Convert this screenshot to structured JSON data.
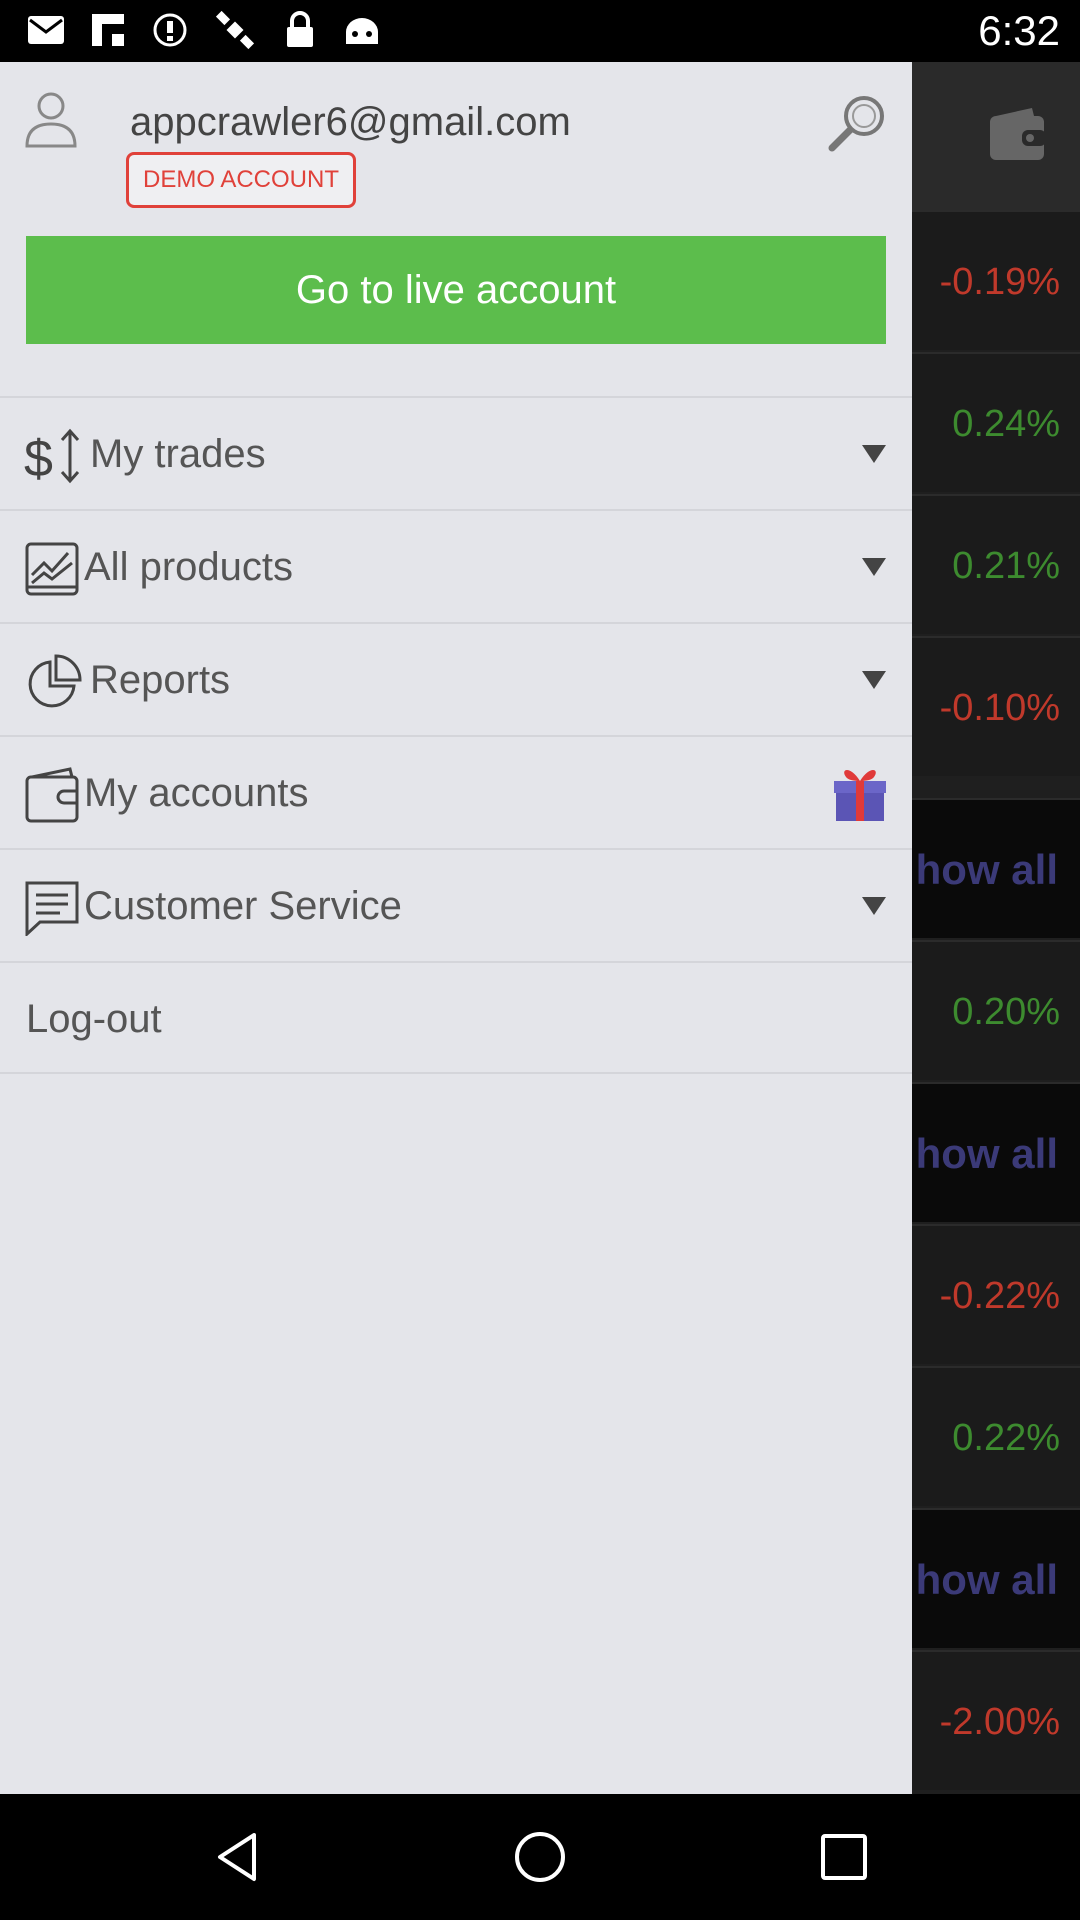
{
  "status_bar": {
    "time": "6:32",
    "icons": [
      "mail-icon",
      "flipboard-icon",
      "alert-icon",
      "satellite-icon",
      "lock-icon",
      "android-icon"
    ]
  },
  "drawer": {
    "email": "appcrawler6@gmail.com",
    "badge": "DEMO ACCOUNT",
    "live_button": "Go to live account",
    "menu": [
      {
        "label": "My trades",
        "icon": "dollar-swap-icon",
        "trailing": "dropdown-arrow-icon"
      },
      {
        "label": "All products",
        "icon": "chart-icon",
        "trailing": "dropdown-arrow-icon"
      },
      {
        "label": "Reports",
        "icon": "pie-chart-icon",
        "trailing": "dropdown-arrow-icon"
      },
      {
        "label": "My accounts",
        "icon": "wallet-icon",
        "trailing": "gift-icon"
      },
      {
        "label": "Customer Service",
        "icon": "chat-icon",
        "trailing": "dropdown-arrow-icon"
      }
    ],
    "logout": "Log-out"
  },
  "background": {
    "rows": [
      "-0.19%",
      "0.24%",
      "0.21%",
      "-0.10%",
      "how all",
      "0.20%",
      "how all",
      "-0.22%",
      "0.22%",
      "how all",
      "-2.00%"
    ]
  },
  "colors": {
    "accent_green": "#5cbd4c",
    "badge_red": "#e0413a",
    "negative": "#c0392b",
    "positive": "#3d8b2f"
  }
}
